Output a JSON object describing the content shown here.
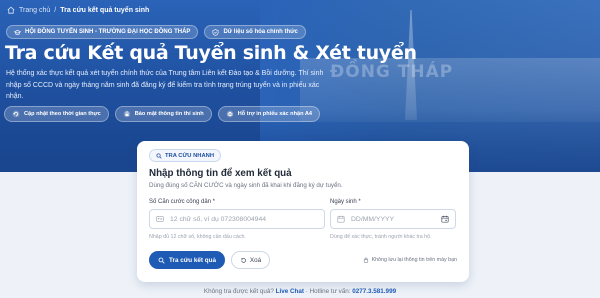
{
  "breadcrumb": {
    "home": "Trang chủ",
    "current": "Tra cứu kết quả tuyển sinh"
  },
  "badges": [
    {
      "label": "HỘI ĐỒNG TUYỂN SINH - TRƯỜNG ĐẠI HỌC ĐỒNG THÁP",
      "icon": "graduation-cap-icon"
    },
    {
      "label": "Dữ liệu số hóa chính thức",
      "icon": "shield-check-icon"
    }
  ],
  "hero": {
    "title": "Tra cứu Kết quả Tuyển sinh & Xét tuyển",
    "description": "Hệ thống xác thực kết quả xét tuyển chính thức của Trung tâm Liên kết Đào tạo & Bồi dưỡng. Thí sinh nhập số CCCD và ngày tháng năm sinh đã đăng ký để kiểm tra tình trạng trúng tuyển và in phiếu xác nhận.",
    "background_text": "ĐỒNG THÁP"
  },
  "features": [
    {
      "label": "Cập nhật theo thời gian thực",
      "icon": "refresh-icon"
    },
    {
      "label": "Bảo mật thông tin thí sinh",
      "icon": "lock-icon"
    },
    {
      "label": "Hỗ trợ in phiếu xác nhận A4",
      "icon": "printer-icon"
    }
  ],
  "card": {
    "chip": "TRA CỨU NHANH",
    "title": "Nhập thông tin để xem kết quả",
    "subtitle": "Dùng đúng số CĂN CƯỚC và ngày sinh đã khai khi đăng ký dự tuyển.",
    "id_field": {
      "label": "Số Căn cước công dân *",
      "placeholder": "12 chữ số, ví dụ 072308004944",
      "hint": "Nhập đủ 12 chữ số, không cần dấu cách."
    },
    "dob_field": {
      "label": "Ngày sinh *",
      "placeholder": "DD/MM/YYYY",
      "hint": "Dùng để xác thực, tránh người khác tra hộ."
    },
    "submit_label": "Tra cứu kết quả",
    "clear_label": "Xoá",
    "privacy_note": "Không lưu lại thông tin trên máy bạn"
  },
  "footer": {
    "question": "Không tra được kết quả?",
    "live_chat": "Live Chat",
    "hotline_label": "Hotline tư vấn:",
    "hotline": "0277.3.581.999"
  },
  "colors": {
    "primary": "#1e5bb5",
    "hero": "#2a63b8",
    "background": "#eef2f8"
  }
}
